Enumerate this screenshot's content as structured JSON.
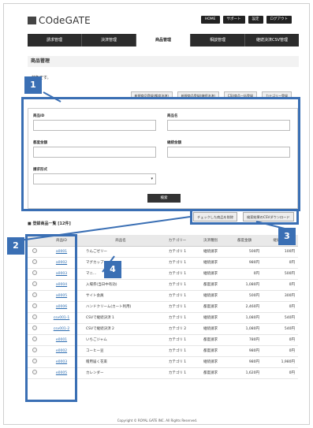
{
  "header": {
    "logo": "COdeGATE",
    "buttons": [
      "HOME",
      "サポート",
      "設定",
      "ログアウト"
    ]
  },
  "nav": {
    "items": [
      "請求管理",
      "決済管理",
      "商品管理",
      "相談管理",
      "継続決済CSV管理"
    ],
    "active_index": 2
  },
  "page": {
    "title": "商品管理",
    "notice": "…対象です。"
  },
  "actions": [
    "新規商品登録(都度決済)",
    "新規商品登録(継続決済)",
    "CSV商品一括登録",
    "カテゴリー登録"
  ],
  "search": {
    "product_id_label": "商品ID",
    "product_name_label": "商品名",
    "base_amount_label": "都度金額",
    "recurring_amount_label": "継続金額",
    "billing_label": "請求形式",
    "search_button": "検索"
  },
  "bulk": {
    "delete_button": "チェックした商品を削除",
    "download_button": "検索結果のCSVダウンロード"
  },
  "list": {
    "title": "■ 登録商品一覧 [12件]",
    "headers": [
      "",
      "商品ID",
      "商品名",
      "カテゴリー",
      "決済種別",
      "都度金額",
      "継続金額"
    ],
    "rows": [
      [
        "",
        "a0001",
        "りんごゼリー",
        "カテゴリ 1",
        "継続請求",
        "500円",
        "100円"
      ],
      [
        "",
        "a0002",
        "マグカップ",
        "カテゴリ 1",
        "継続請求",
        "980円",
        "0円"
      ],
      [
        "",
        "a0003",
        "マニ...",
        "カテゴリ 1",
        "継続請求",
        "0円",
        "500円"
      ],
      [
        "",
        "a0004",
        "入場券(当日中有効)",
        "カテゴリ 1",
        "都度請求",
        "1,080円",
        "0円"
      ],
      [
        "",
        "a0005",
        "サイト会員",
        "カテゴリ 1",
        "継続請求",
        "500円",
        "300円"
      ],
      [
        "",
        "a0006",
        "ハンドクリーム(カート利用)",
        "カテゴリ 1",
        "都度請求",
        "2,460円",
        "0円"
      ],
      [
        "",
        "csv001-1",
        "CSVで継続決済 1",
        "カテゴリ 1",
        "継続請求",
        "1,080円",
        "540円"
      ],
      [
        "",
        "csv001-2",
        "CSVで継続決済 2",
        "カテゴリ 2",
        "継続請求",
        "1,080円",
        "540円"
      ],
      [
        "",
        "e0001",
        "いちごジャム",
        "カテゴリ 1",
        "都度請求",
        "780円",
        "0円"
      ],
      [
        "",
        "e0002",
        "コーヒー豆",
        "カテゴリ 1",
        "都度請求",
        "980円",
        "0円"
      ],
      [
        "",
        "e0003",
        "贈用届く花束",
        "カテゴリ 1",
        "継続請求",
        "980円",
        "1,980円"
      ],
      [
        "",
        "e0005",
        "カレンダー",
        "カテゴリ 1",
        "都度請求",
        "1,620円",
        "0円"
      ]
    ]
  },
  "footer": "Copyright © ROYAL GATE INC. All Rights Reserved.",
  "callouts": [
    "1",
    "2",
    "3",
    "4"
  ],
  "colors": {
    "accent": "#3a6fb4",
    "nav": "#2c2c2c"
  }
}
